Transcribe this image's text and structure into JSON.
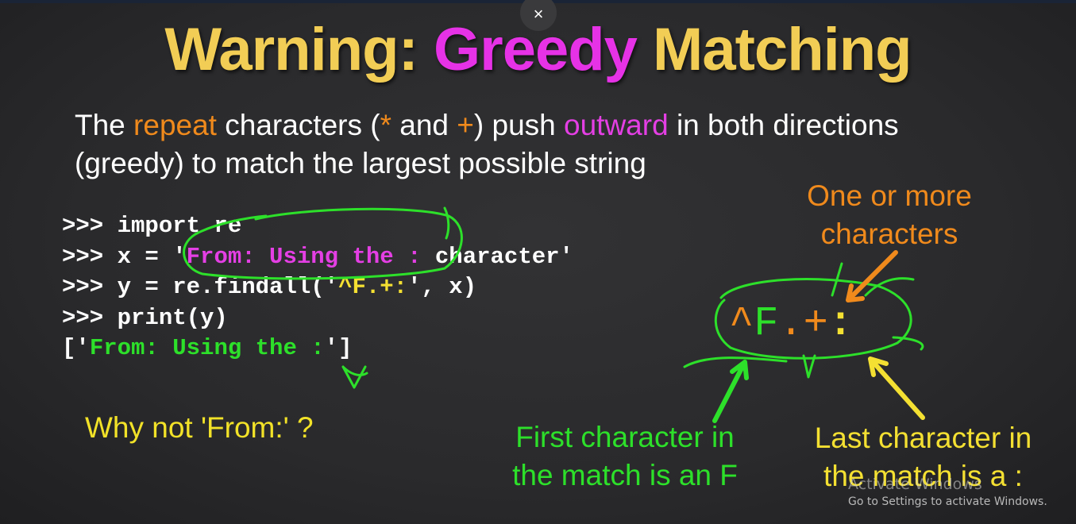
{
  "slide": {
    "title_part1": "Warning: ",
    "title_part2": "Greedy",
    "title_part3": " Matching",
    "subtitle": {
      "s1": "The ",
      "s2": "repeat",
      "s3": " characters (",
      "s4": "*",
      "s5": " and ",
      "s6": "+",
      "s7": ") push ",
      "s8": "outward",
      "s9": " in both directions",
      "line2": "(greedy) to match the largest possible string"
    },
    "code": {
      "line1": ">>> import re",
      "line2_a": ">>> x = '",
      "line2_b": "From: Using the :",
      "line2_c": " character'",
      "line3_a": ">>> y = re.findall('",
      "line3_b": "^F.+:",
      "line3_c": "', x)",
      "line4": ">>> print(y)",
      "line5_a": "['",
      "line5_b": "From: Using the :",
      "line5_c": "']"
    },
    "why": "Why not 'From:' ?",
    "regex": {
      "caret": "^",
      "f": "F",
      "dot": ".",
      "plus": "+",
      "colon": ":"
    },
    "labels": {
      "one_or_more_line1": "One or more",
      "one_or_more_line2": "characters",
      "first_line1": "First character in",
      "first_line2": "the match is an F",
      "last_line1": "Last character in",
      "last_line2": "the match is a :"
    }
  },
  "controls": {
    "close_icon": "×"
  },
  "watermark": {
    "title": "Activate Windows",
    "subtitle": "Go to Settings to activate Windows."
  },
  "colors": {
    "background": "#2a2a2c",
    "title_gold": "#f2cd55",
    "magenta": "#e632e6",
    "orange": "#f08a1c",
    "yellow": "#f4e032",
    "green": "#2de02a"
  }
}
